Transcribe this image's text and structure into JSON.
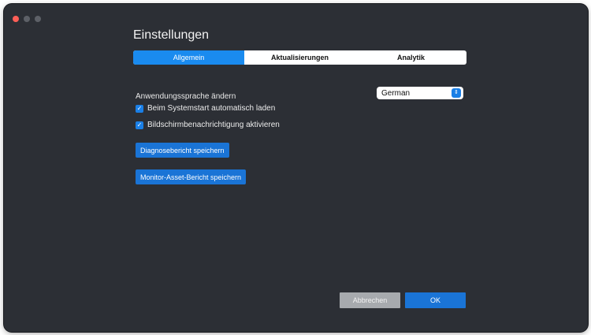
{
  "window": {
    "title": "Einstellungen"
  },
  "tabs": [
    {
      "label": "Allgemein",
      "active": true
    },
    {
      "label": "Aktualisierungen",
      "active": false
    },
    {
      "label": "Analytik",
      "active": false
    }
  ],
  "language": {
    "label": "Anwendungssprache ändern",
    "selected": "German",
    "stepper_glyph": "⇕"
  },
  "checkboxes": [
    {
      "label": "Beim Systemstart automatisch laden",
      "checked": true
    },
    {
      "label": "Bildschirmbenachrichtigung aktivieren",
      "checked": true
    }
  ],
  "checkmark": "✓",
  "buttons": {
    "diagnostics": "Diagnosebericht speichern",
    "asset_report": "Monitor-Asset-Bericht speichern"
  },
  "footer": {
    "cancel": "Abbrechen",
    "ok": "OK"
  },
  "colors": {
    "accent": "#1a74d6",
    "tab_active": "#1a8bef",
    "window_bg": "#2c2f35"
  }
}
